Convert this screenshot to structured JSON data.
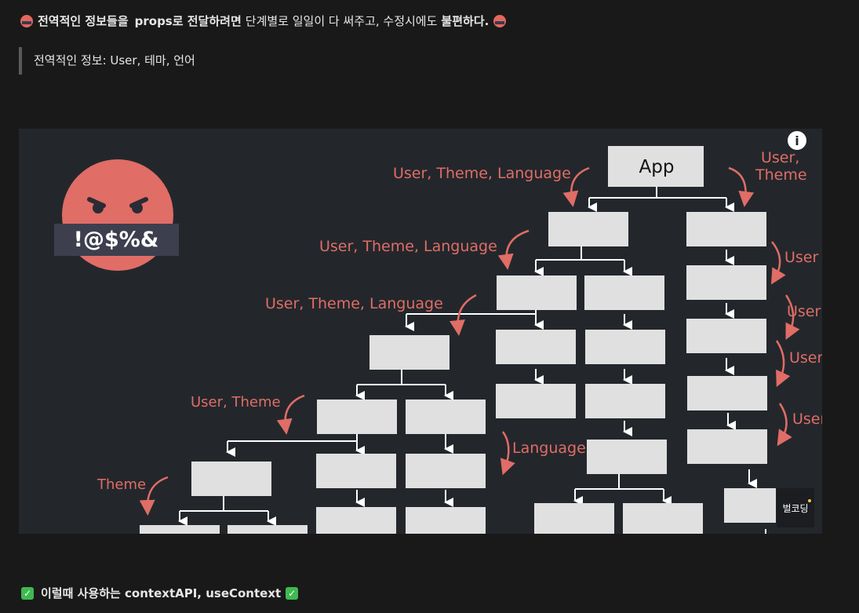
{
  "header": {
    "title_bold_1": "전역적인 정보들을",
    "title_bold_2": "props로 전달하려면",
    "title_normal": "단계별로 일일이 다 써주고, 수정시에도",
    "title_bold_3": "불편하다."
  },
  "quote": {
    "text": "전역적인 정보: User, 테마, 언어"
  },
  "diagram": {
    "app_label": "App",
    "curse_text": "!@$%&",
    "info_icon": "i",
    "watermark": "벌코딩",
    "labels": {
      "l1": "User, Theme, Language",
      "l2": "User, Theme, Language",
      "l3": "User, Theme, Language",
      "l4": "User, Theme",
      "l5": "Theme",
      "l6": "Language",
      "r_user_theme_1": "User,",
      "r_user_theme_2": "Theme",
      "r_user_1": "User",
      "r_user_2": "User",
      "r_user_3": "User",
      "r_user_4": "User"
    }
  },
  "footer": {
    "text": "이럴때 사용하는 contextAPI, useContext"
  },
  "colors": {
    "accent_red": "#e06d66",
    "box": "#e0e0e0",
    "background": "#23272c"
  }
}
